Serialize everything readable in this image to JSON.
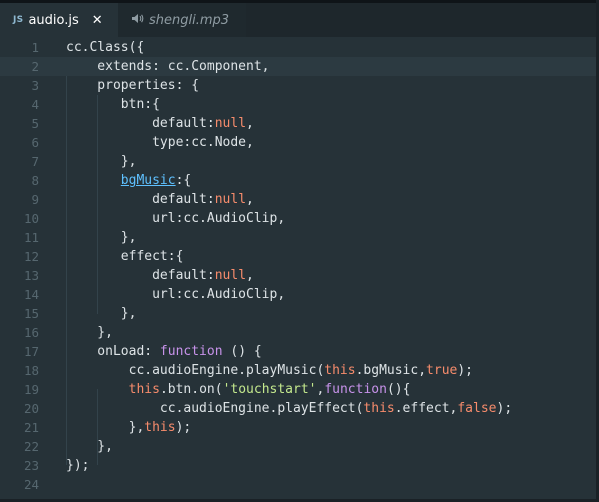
{
  "tabs": [
    {
      "badge": "JS",
      "label": "audio.js",
      "close": "✕",
      "active": true
    },
    {
      "label": "shengli.mp3",
      "active": false
    }
  ],
  "lines": [
    {
      "num": "1",
      "segs": [
        {
          "t": "cc.Class({"
        }
      ]
    },
    {
      "num": "2",
      "segs": [
        {
          "t": "    extends: cc.Component,"
        }
      ],
      "current": true
    },
    {
      "num": "3",
      "segs": [
        {
          "t": "    properties: {"
        }
      ]
    },
    {
      "num": "4",
      "segs": [
        {
          "t": "       btn:{"
        }
      ]
    },
    {
      "num": "5",
      "segs": [
        {
          "t": "           default:"
        },
        {
          "t": "null",
          "c": "kw-null"
        },
        {
          "t": ","
        }
      ]
    },
    {
      "num": "6",
      "segs": [
        {
          "t": "           type:cc.Node,"
        }
      ]
    },
    {
      "num": "7",
      "segs": [
        {
          "t": "       },"
        }
      ]
    },
    {
      "num": "8",
      "segs": [
        {
          "t": "       "
        },
        {
          "t": "bgMusic",
          "c": "link"
        },
        {
          "t": ":{"
        }
      ]
    },
    {
      "num": "9",
      "segs": [
        {
          "t": "           default:"
        },
        {
          "t": "null",
          "c": "kw-null"
        },
        {
          "t": ","
        }
      ]
    },
    {
      "num": "10",
      "segs": [
        {
          "t": "           url:cc.AudioClip,"
        }
      ]
    },
    {
      "num": "11",
      "segs": [
        {
          "t": "       },"
        }
      ]
    },
    {
      "num": "12",
      "segs": [
        {
          "t": "       effect:{"
        }
      ]
    },
    {
      "num": "13",
      "segs": [
        {
          "t": "           default:"
        },
        {
          "t": "null",
          "c": "kw-null"
        },
        {
          "t": ","
        }
      ]
    },
    {
      "num": "14",
      "segs": [
        {
          "t": "           url:cc.AudioClip,"
        }
      ]
    },
    {
      "num": "15",
      "segs": [
        {
          "t": "       },"
        }
      ]
    },
    {
      "num": "16",
      "segs": [
        {
          "t": "    },"
        }
      ]
    },
    {
      "num": "17",
      "segs": [
        {
          "t": "    onLoad: "
        },
        {
          "t": "function",
          "c": "kw-fn"
        },
        {
          "t": " () {"
        }
      ]
    },
    {
      "num": "18",
      "segs": [
        {
          "t": "        cc.audioEngine.playMusic("
        },
        {
          "t": "this",
          "c": "kw-this"
        },
        {
          "t": ".bgMusic,"
        },
        {
          "t": "true",
          "c": "kw-null"
        },
        {
          "t": ");"
        }
      ]
    },
    {
      "num": "19",
      "segs": [
        {
          "t": "        "
        },
        {
          "t": "this",
          "c": "kw-this"
        },
        {
          "t": ".btn.on("
        },
        {
          "t": "'touchstart'",
          "c": "str"
        },
        {
          "t": ","
        },
        {
          "t": "function",
          "c": "kw-fn"
        },
        {
          "t": "(){"
        }
      ]
    },
    {
      "num": "20",
      "segs": [
        {
          "t": "            cc.audioEngine.playEffect("
        },
        {
          "t": "this",
          "c": "kw-this"
        },
        {
          "t": ".effect,"
        },
        {
          "t": "false",
          "c": "kw-null"
        },
        {
          "t": ");"
        }
      ]
    },
    {
      "num": "21",
      "segs": [
        {
          "t": "        },"
        },
        {
          "t": "this",
          "c": "kw-this"
        },
        {
          "t": ");"
        }
      ]
    },
    {
      "num": "22",
      "segs": [
        {
          "t": "    },"
        }
      ]
    },
    {
      "num": "23",
      "segs": [
        {
          "t": "});"
        }
      ]
    },
    {
      "num": "24",
      "segs": [
        {
          "t": ""
        }
      ]
    }
  ],
  "colors": {
    "background": "#263238",
    "keyword_value": "#f78c6c",
    "keyword_function": "#c792ea",
    "string": "#c3e88d",
    "link": "#5fc1ff"
  }
}
